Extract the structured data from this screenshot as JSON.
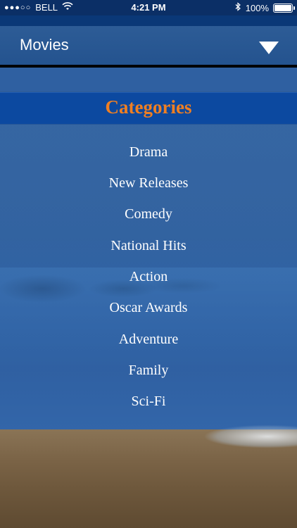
{
  "status_bar": {
    "signal": "●●●○○",
    "carrier": "BELL",
    "time": "4:21 PM",
    "battery_percent": "100%"
  },
  "header": {
    "title": "Movies"
  },
  "categories": {
    "title": "Categories",
    "items": [
      {
        "label": "Drama"
      },
      {
        "label": "New Releases"
      },
      {
        "label": "Comedy"
      },
      {
        "label": "National Hits"
      },
      {
        "label": "Action"
      },
      {
        "label": "Oscar Awards"
      },
      {
        "label": "Adventure"
      },
      {
        "label": "Family"
      },
      {
        "label": "Sci-Fi"
      }
    ]
  },
  "colors": {
    "accent_orange": "#ef7f22",
    "header_blue": "#0c49a0"
  }
}
